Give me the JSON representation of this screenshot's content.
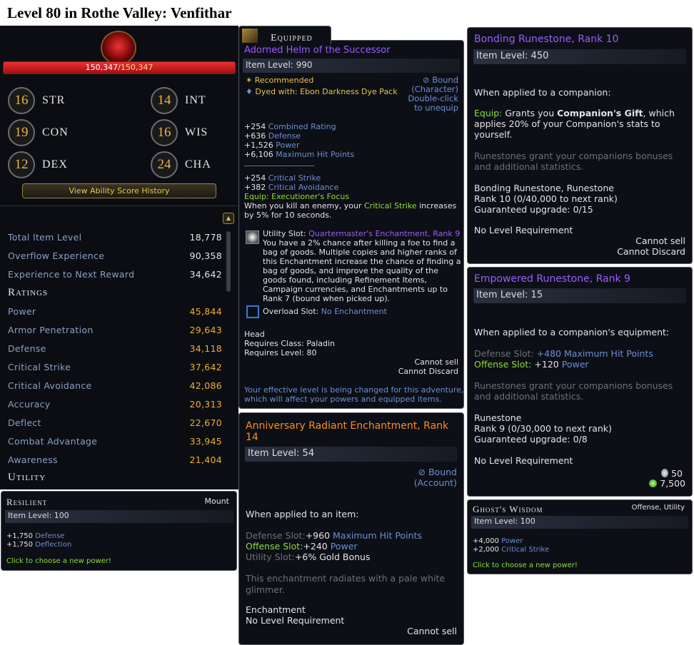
{
  "page_title": "Level 80 in Rothe Valley: Venfithar",
  "char": {
    "hp": "150,347",
    "hp_max": "/150,347",
    "abilities": [
      {
        "v": "16",
        "k": "STR"
      },
      {
        "v": "14",
        "k": "INT"
      },
      {
        "v": "19",
        "k": "CON"
      },
      {
        "v": "16",
        "k": "WIS"
      },
      {
        "v": "12",
        "k": "DEX"
      },
      {
        "v": "24",
        "k": "CHA"
      }
    ],
    "history_btn": "View Ability Score History",
    "stats": [
      {
        "k": "Total Item Level",
        "v": "18,778"
      },
      {
        "k": "Overflow Experience",
        "v": "90,358"
      },
      {
        "k": "Experience to Next Reward",
        "v": "34,642"
      }
    ],
    "ratings_h": "Ratings",
    "ratings": [
      {
        "k": "Power",
        "v": "45,844"
      },
      {
        "k": "Armor Penetration",
        "v": "29,643"
      },
      {
        "k": "Defense",
        "v": "34,118"
      },
      {
        "k": "Critical Strike",
        "v": "37,642"
      },
      {
        "k": "Critical Avoidance",
        "v": "42,086"
      },
      {
        "k": "Accuracy",
        "v": "20,313"
      },
      {
        "k": "Deflect",
        "v": "22,670"
      },
      {
        "k": "Combat Advantage",
        "v": "33,945"
      },
      {
        "k": "Awareness",
        "v": "21,404"
      }
    ],
    "utility_h": "Utility"
  },
  "resilient": {
    "title": "Resilient",
    "type": "Mount",
    "ilvl": "Item Level: 100",
    "s1": "+1,750",
    "s1k": "Defense",
    "s2": "+1,750",
    "s2k": "Deflection",
    "click": "Click to choose a new power!"
  },
  "helm": {
    "equipped": "Equipped",
    "name": "Adorned Helm of the Successor",
    "ilvl": "Item Level: 990",
    "recommended": "Recommended",
    "dyed": "Dyed with: Ebon Darkness Dye Pack",
    "bound": "Bound",
    "bound2": "(Character)",
    "dbl": "Double-click",
    "dbl2": "to unequip",
    "stats1": [
      {
        "n": "+254",
        "k": "Combined Rating"
      },
      {
        "n": "+636",
        "k": "Defense"
      },
      {
        "n": "+1,526",
        "k": "Power"
      },
      {
        "n": "+6,106",
        "k": "Maximum Hit Points"
      }
    ],
    "stats2": [
      {
        "n": "+254",
        "k": "Critical Strike"
      },
      {
        "n": "+382",
        "k": "Critical Avoidance"
      }
    ],
    "equip": "Equip: Executioner's Focus",
    "kill1": "When you kill an enemy, your",
    "kill_cs": "Critical Strike",
    "kill2": "increases",
    "kill3": "by 5% for 10 seconds.",
    "util_label": "Utility Slot:",
    "util_name": "Quartermaster's Enchantment, Rank 9",
    "util_desc": [
      "You have a 2% chance after killing a foe to find a",
      "bag of goods. Multiple copies and higher ranks of",
      "this Enchantment increase the chance of finding a",
      "bag of goods, and improve the quality of the",
      "goods found, including Refinement Items,",
      "Campaign currencies, and Enchantments up to",
      "Rank 7 (bound when picked up)."
    ],
    "overload": "Overload Slot:",
    "overload_v": "No Enchantment",
    "slot": "Head",
    "req_class": "Requires Class: Paladin",
    "req_level": "Requires Level: 80",
    "cannot_sell": "Cannot sell",
    "cannot_discard": "Cannot Discard",
    "eff1": "Your effective level is being changed for this adventure,",
    "eff2": "which will affect your powers and equipped items."
  },
  "bonding": {
    "name": "Bonding Runestone, Rank 10",
    "ilvl": "Item Level: 450",
    "applied": "When applied to a companion:",
    "equip_pre": "Equip:",
    "equip_mid": "Grants you",
    "gift": "Companion's Gift",
    "equip_post": ", which",
    "line2": "applies 20% of your Companion's stats to",
    "line3": "yourself.",
    "grant1": "Runestones grant your companions bonuses",
    "grant2": "and additional statistics.",
    "type": "Bonding Runestone, Runestone",
    "rank": "Rank 10 (0/40,000 to next rank)",
    "guar": "Guaranteed upgrade: 0/15",
    "nolevel": "No Level Requirement",
    "cs": "Cannot sell",
    "cd": "Cannot Discard"
  },
  "empowered": {
    "name": "Empowered Runestone, Rank 9",
    "ilvl": "Item Level: 15",
    "applied": "When applied to a companion's equipment:",
    "def_slot": "Defense Slot:",
    "def_val": "+480 Maximum Hit Points",
    "off_slot": "Offense Slot:",
    "off_val": "+120",
    "off_k": "Power",
    "grant1": "Runestones grant your companions bonuses",
    "grant2": "and additional statistics.",
    "type": "Runestone",
    "rank": "Rank 9 (0/30,000 to next rank)",
    "guar": "Guaranteed upgrade: 0/8",
    "nolevel": "No Level Requirement",
    "coin1": "50",
    "coin2": "7,500"
  },
  "anniv": {
    "name1": "Anniversary Radiant Enchantment, Rank",
    "name2": "14",
    "ilvl": "Item Level: 54",
    "bound": "Bound",
    "bound2": "(Account)",
    "applied": "When applied to an item:",
    "def": "Defense Slot:",
    "def_v": "+960",
    "def_k": "Maximum Hit Points",
    "off": "Offense Slot:",
    "off_v": "+240",
    "off_k": "Power",
    "util": "Utility Slot:",
    "util_v": "+6% Gold Bonus",
    "desc1": "This enchantment radiates with a pale white",
    "desc2": "glimmer.",
    "type": "Enchantment",
    "nolevel": "No Level Requirement",
    "cs": "Cannot sell"
  },
  "ghost": {
    "title": "Ghost's Wisdom",
    "type": "Offense, Utility",
    "ilvl": "Item Level: 100",
    "s1": "+4,000",
    "s1k": "Power",
    "s2": "+2,000",
    "s2k": "Critical Strike",
    "click": "Click to choose a new power!"
  },
  "colors": {
    "hp_bar": "#c8181c",
    "accent_blue": "#6d8fd1",
    "green": "#8dde3a",
    "gold": "#f0b030",
    "purple": "#9c5cff",
    "orange": "#ff8c1a"
  }
}
